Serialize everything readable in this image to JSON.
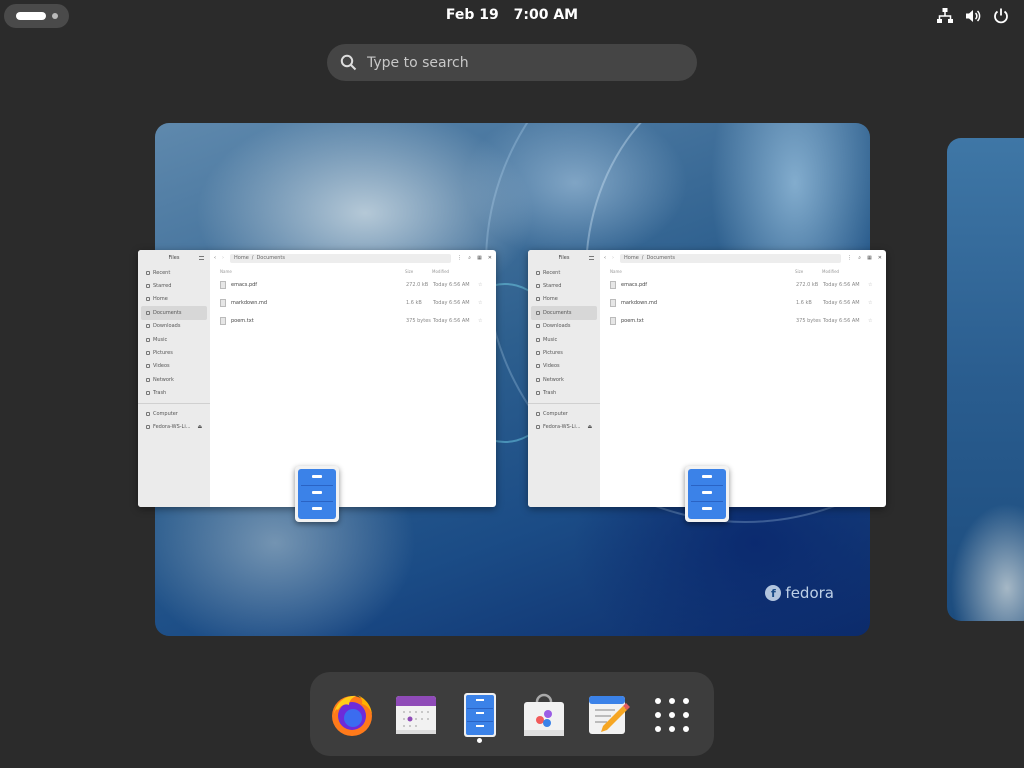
{
  "topbar": {
    "date": "Feb 19",
    "time": "7:00 AM",
    "tray_icons": [
      "network-icon",
      "volume-icon",
      "power-icon"
    ]
  },
  "search": {
    "placeholder": "Type to search"
  },
  "workspace": {
    "brand": "fedora"
  },
  "windows": [
    {
      "title": "Files",
      "sidebar": [
        "Recent",
        "Starred",
        "Home",
        "Documents",
        "Downloads",
        "Music",
        "Pictures",
        "Videos",
        "Network",
        "Trash"
      ],
      "devices": [
        "Computer",
        "Fedora-WS-Li..."
      ],
      "active_item": "Documents",
      "breadcrumb": [
        "Home",
        "Documents"
      ],
      "columns": [
        "Name",
        "Size",
        "Modified"
      ],
      "files": [
        {
          "name": "emacs.pdf",
          "size": "272.0 kB",
          "modified": "Today 6:56 AM"
        },
        {
          "name": "markdown.md",
          "size": "1.6 kB",
          "modified": "Today 6:56 AM"
        },
        {
          "name": "poem.txt",
          "size": "375 bytes",
          "modified": "Today 6:56 AM"
        }
      ]
    },
    {
      "title": "Files",
      "sidebar": [
        "Recent",
        "Starred",
        "Home",
        "Documents",
        "Downloads",
        "Music",
        "Pictures",
        "Videos",
        "Network",
        "Trash"
      ],
      "devices": [
        "Computer",
        "Fedora-WS-Li..."
      ],
      "active_item": "Documents",
      "breadcrumb": [
        "Home",
        "Documents"
      ],
      "columns": [
        "Name",
        "Size",
        "Modified"
      ],
      "files": [
        {
          "name": "emacs.pdf",
          "size": "272.0 kB",
          "modified": "Today 6:56 AM"
        },
        {
          "name": "markdown.md",
          "size": "1.6 kB",
          "modified": "Today 6:56 AM"
        },
        {
          "name": "poem.txt",
          "size": "375 bytes",
          "modified": "Today 6:56 AM"
        }
      ]
    }
  ],
  "dash": {
    "apps": [
      "firefox-icon",
      "calendar-icon",
      "files-icon",
      "software-icon",
      "text-editor-icon",
      "app-grid-icon"
    ],
    "running": "files-icon"
  }
}
